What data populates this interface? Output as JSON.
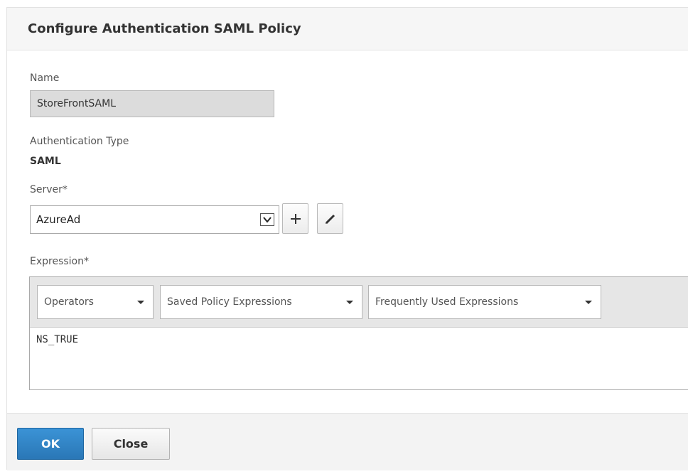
{
  "dialog": {
    "title": "Configure Authentication SAML Policy"
  },
  "form": {
    "name_label": "Name",
    "name_value": "StoreFrontSAML",
    "auth_type_label": "Authentication Type",
    "auth_type_value": "SAML",
    "server_label": "Server*",
    "server_value": "AzureAd",
    "expression_label": "Expression*",
    "expression_toolbar": {
      "operators": "Operators",
      "saved_policy_expressions": "Saved Policy Expressions",
      "frequently_used_expressions": "Frequently Used Expressions"
    },
    "expression_value": "NS_TRUE"
  },
  "footer": {
    "ok_label": "OK",
    "close_label": "Close"
  },
  "icons": {
    "add": "plus-icon",
    "edit": "pencil-icon",
    "dropdown": "chevron-down-icon"
  },
  "colors": {
    "primary_button": "#2f82c4",
    "header_bg": "#f6f6f6",
    "readonly_field_bg": "#dcdcdc"
  }
}
